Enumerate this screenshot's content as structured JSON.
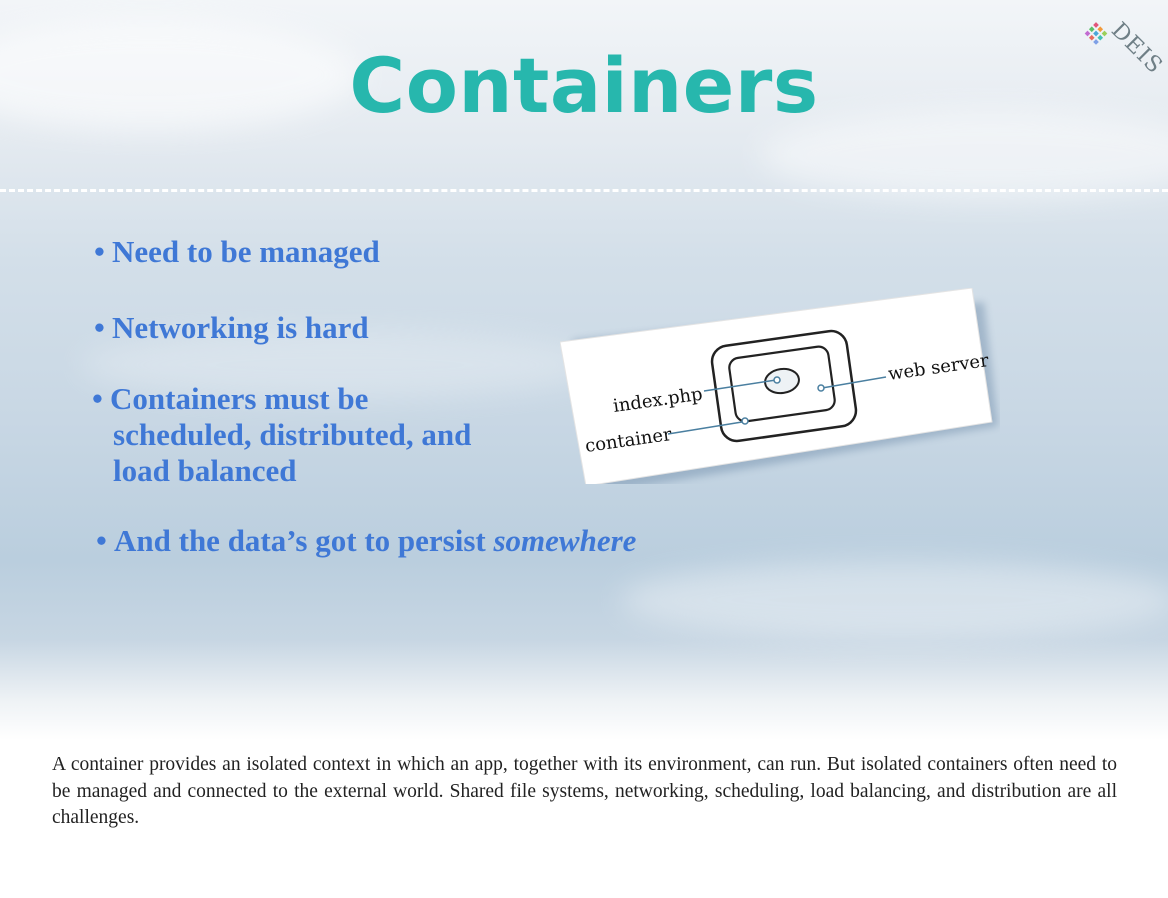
{
  "slide": {
    "title": "Containers",
    "logo_text": "DEIS",
    "bullets": [
      {
        "text": "Need to be managed"
      },
      {
        "text": "Networking is hard"
      },
      {
        "lines": [
          "Containers must be",
          "scheduled, distributed, and",
          "load balanced"
        ]
      },
      {
        "text": "And the data’s got to persist ",
        "emphasis": "somewhere"
      }
    ],
    "diagram": {
      "labels": {
        "index": "index.php",
        "container": "container",
        "webserver": "web server"
      }
    }
  },
  "caption": "A container provides an isolated context in which an app, together with its environment, can run. But isolated containers often need to be managed and connected to the external world. Shared file systems, networking, scheduling, load balancing, and distribution are all challenges.",
  "colors": {
    "title": "#27b7ad",
    "bullets": "#3f78d6",
    "caption": "#222222"
  }
}
